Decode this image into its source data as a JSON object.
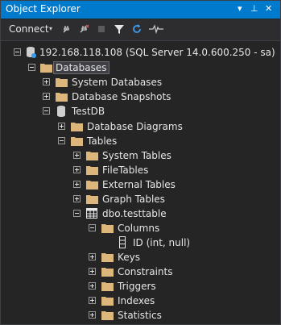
{
  "panel": {
    "title": "Object Explorer",
    "pin_glyph": "▾",
    "pin2_glyph": "⊥",
    "close_glyph": "✕"
  },
  "toolbar": {
    "connect_label": "Connect",
    "connect_caret": "▾"
  },
  "tree": {
    "server": "192.168.118.108 (SQL Server 14.0.600.250 - sa)",
    "databases": "Databases",
    "system_databases": "System Databases",
    "database_snapshots": "Database Snapshots",
    "testdb": "TestDB",
    "database_diagrams": "Database Diagrams",
    "tables": "Tables",
    "system_tables": "System Tables",
    "filetables": "FileTables",
    "external_tables": "External Tables",
    "graph_tables": "Graph Tables",
    "testtable": "dbo.testtable",
    "columns": "Columns",
    "id_column": "ID (int, null)",
    "keys": "Keys",
    "constraints": "Constraints",
    "triggers": "Triggers",
    "indexes": "Indexes",
    "statistics": "Statistics"
  },
  "colors": {
    "title_bar": "#007acc",
    "folder": "#dcb67a",
    "background": "#252526",
    "text": "#e6e6e6"
  }
}
